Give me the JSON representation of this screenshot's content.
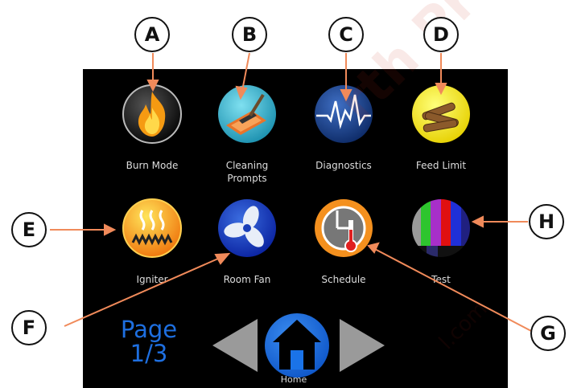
{
  "apps": [
    {
      "key": "burn-mode",
      "label": "Burn Mode",
      "icon": "flame-icon"
    },
    {
      "key": "cleaning-prompts",
      "label": "Cleaning Prompts",
      "icon": "cleaning-scraper-icon"
    },
    {
      "key": "diagnostics",
      "label": "Diagnostics",
      "icon": "heartbeat-icon"
    },
    {
      "key": "feed-limit",
      "label": "Feed Limit",
      "icon": "wood-logs-icon"
    },
    {
      "key": "igniter",
      "label": "Igniter",
      "icon": "heating-coil-icon"
    },
    {
      "key": "room-fan",
      "label": "Room Fan",
      "icon": "fan-icon"
    },
    {
      "key": "schedule",
      "label": "Schedule",
      "icon": "clock-thermometer-icon"
    },
    {
      "key": "test",
      "label": "Test",
      "icon": "color-bars-icon"
    }
  ],
  "page_indicator": {
    "line1": "Page",
    "line2": "1/3"
  },
  "nav": {
    "home_label": "Home",
    "prev_icon": "arrow-left-icon",
    "next_icon": "arrow-right-icon",
    "home_icon": "house-icon"
  },
  "callouts": [
    "A",
    "B",
    "C",
    "D",
    "E",
    "F",
    "G",
    "H"
  ],
  "watermark": {
    "main": "rth Produ",
    "small": "l.com"
  },
  "colors": {
    "screen": "#000000",
    "callout_line": "#f08a5a",
    "page_text": "#1e6fe0",
    "home_blue": "#1a73e8",
    "arrow_gray": "#9a9a9a"
  }
}
